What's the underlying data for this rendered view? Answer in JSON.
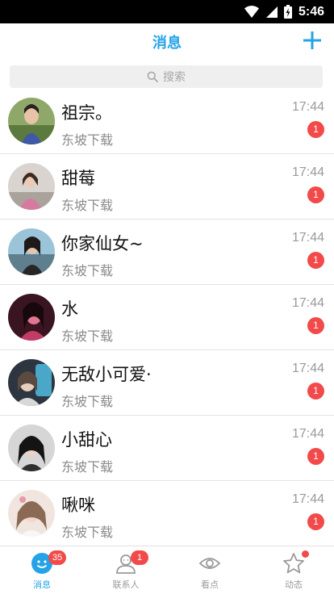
{
  "status_bar": {
    "time": "5:46"
  },
  "header": {
    "title": "消息"
  },
  "search": {
    "placeholder": "搜索"
  },
  "chats": [
    {
      "name": "祖宗。",
      "preview": "东坡下载",
      "time": "17:44",
      "unread": "1"
    },
    {
      "name": "甜莓",
      "preview": "东坡下载",
      "time": "17:44",
      "unread": "1"
    },
    {
      "name": "你家仙女~",
      "preview": "东坡下载",
      "time": "17:44",
      "unread": "1"
    },
    {
      "name": "水",
      "preview": "东坡下载",
      "time": "17:44",
      "unread": "1"
    },
    {
      "name": "无敌小可爱·",
      "preview": "东坡下载",
      "time": "17:44",
      "unread": "1"
    },
    {
      "name": "小甜心",
      "preview": "东坡下载",
      "time": "17:44",
      "unread": "1"
    },
    {
      "name": "啾咪",
      "preview": "东坡下载",
      "time": "17:44",
      "unread": "1"
    }
  ],
  "tabs": [
    {
      "label": "消息",
      "icon": "chat-bubble-face-icon",
      "badge": "35",
      "active": true
    },
    {
      "label": "联系人",
      "icon": "contact-person-icon",
      "badge": "1"
    },
    {
      "label": "看点",
      "icon": "eye-icon"
    },
    {
      "label": "动态",
      "icon": "star-icon",
      "dot": true
    }
  ],
  "colors": {
    "accent": "#25a3e6",
    "badge": "#f24a4a",
    "status_bar": "#000000"
  }
}
